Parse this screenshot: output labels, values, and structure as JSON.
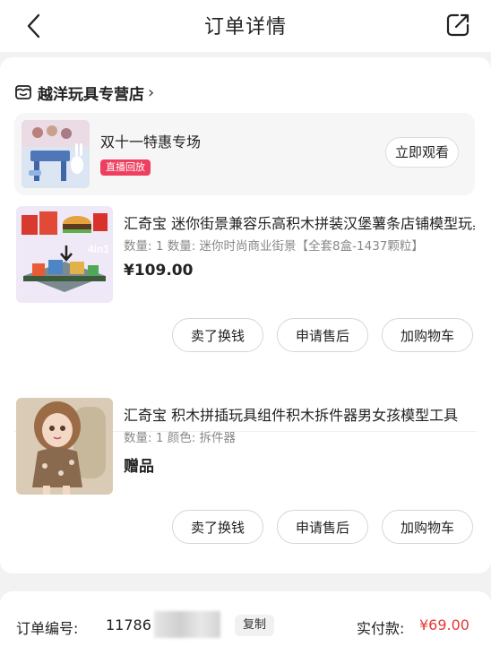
{
  "header": {
    "title": "订单详情",
    "back_icon": "chevron-left-icon",
    "share_icon": "share-icon"
  },
  "store": {
    "name": "越洋玩具专营店",
    "chevron": "›",
    "icon": "store-icon"
  },
  "live_banner": {
    "title": "双十一特惠专场",
    "badge": "直播回放",
    "watch_label": "立即观看"
  },
  "items": [
    {
      "name": "汇奇宝 迷你街景兼容乐高积木拼装汉堡薯条店铺模型玩具",
      "spec": "数量: 1  数量: 迷你时尚商业街景【全套8盒-1437颗粒】",
      "price": "¥109.00",
      "buttons": [
        "卖了换钱",
        "申请售后",
        "加购物车"
      ]
    },
    {
      "name": "汇奇宝 积木拼插玩具组件积木拆件器男女孩模型工具",
      "spec": "数量: 1  颜色: 拆件器",
      "price": "赠品",
      "buttons": [
        "卖了换钱",
        "申请售后",
        "加购物车"
      ]
    }
  ],
  "footer": {
    "order_label": "订单编号:",
    "order_number_visible": "11786",
    "copy_label": "复制",
    "paid_label": "实付款:",
    "paid_amount": "¥69.00"
  },
  "colors": {
    "accent_red": "#e53935",
    "badge_pink": "#ee3f60"
  }
}
